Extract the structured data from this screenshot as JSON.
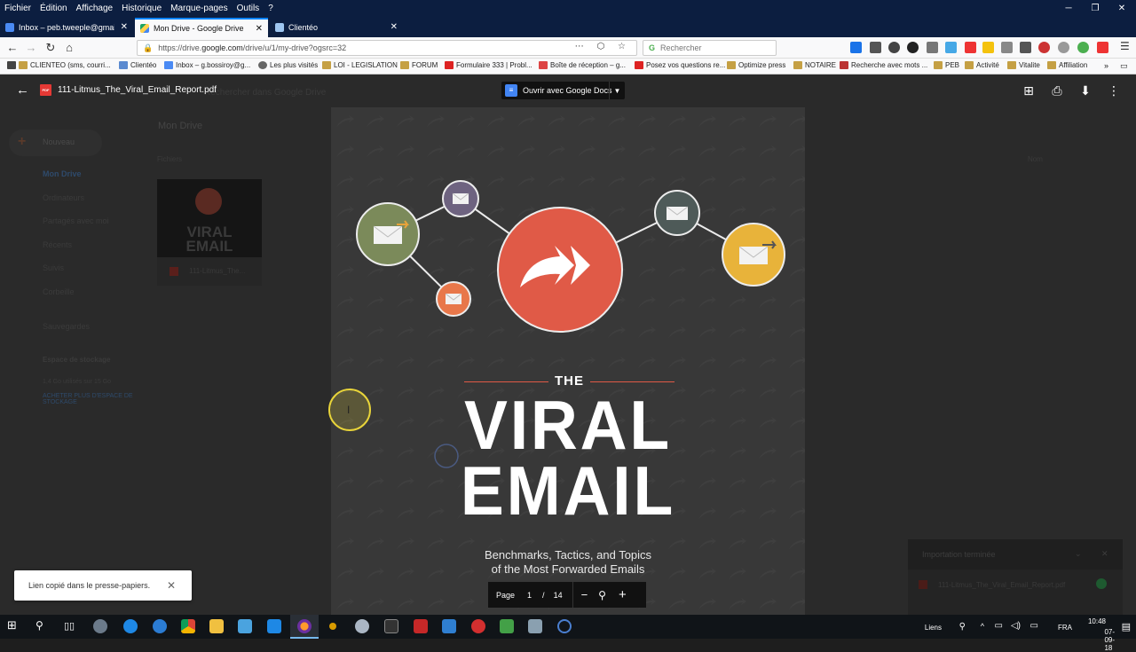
{
  "browser": {
    "menu": [
      "Fichier",
      "Édition",
      "Affichage",
      "Historique",
      "Marque-pages",
      "Outils",
      "?"
    ],
    "tabs": [
      {
        "label": "Inbox – peb.tweeple@gmail.co",
        "active": false
      },
      {
        "label": "Mon Drive - Google Drive",
        "active": true
      },
      {
        "label": "Clientéo",
        "active": false
      }
    ],
    "url_prefix": "https://drive.",
    "url_host": "google.com",
    "url_rest": "/drive/u/1/my-drive?ogsrc=32",
    "search_placeholder": "Rechercher",
    "bookmarks": [
      "CLIENTEO (sms, courri...",
      "Clientéo",
      "Inbox – g.bossiroy@g...",
      "Les plus visités",
      "LOI - LEGISLATION",
      "FORUM",
      "Formulaire 333 | Probl...",
      "Boîte de réception – g...",
      "Posez vos questions re...",
      "Optimize press",
      "NOTAIRE",
      "Recherche avec mots ...",
      "PEB",
      "Activité",
      "Vitalite",
      "Affiliation"
    ]
  },
  "drive": {
    "search_hint": "Rechercher dans Google Drive",
    "new_button": "Nouveau",
    "breadcrumb": "Mon Drive",
    "section_files": "Fichiers",
    "sort_label": "Nom",
    "sidebar": [
      "Mon Drive",
      "Ordinateurs",
      "Partagés avec moi",
      "Récents",
      "Suivis",
      "Corbeille",
      "Sauvegardes",
      "Espace de stockage"
    ],
    "storage_used": "1,4 Go utilisés sur 15 Go",
    "buy_storage": "ACHETER PLUS D'ESPACE DE STOCKAGE",
    "thumb_title_1": "VIRAL",
    "thumb_title_2": "EMAIL",
    "file_name_short": "111-Litmus_The..."
  },
  "viewer": {
    "file_name": "111-Litmus_The_Viral_Email_Report.pdf",
    "pdf_badge": "PDF",
    "open_with": "Ouvrir avec Google Docs",
    "page_label": "Page",
    "page_current": "1",
    "page_sep": "/",
    "page_total": "14"
  },
  "pdf": {
    "the": "THE",
    "title_line1": "VIRAL",
    "title_line2": "EMAIL",
    "subtitle_line1": "Benchmarks, Tactics, and Topics",
    "subtitle_line2": "of the Most Forwarded Emails"
  },
  "toast": {
    "message": "Lien copié dans le presse-papiers."
  },
  "import_panel": {
    "title": "Importation terminée",
    "file": "111-Litmus_The_Viral_Email_Report.pdf"
  },
  "taskbar": {
    "links": "Liens",
    "lang": "FRA",
    "time": "10:48",
    "date": "07-09-18"
  },
  "colors": {
    "accent_red": "#e05a47",
    "olive": "#7b8a5a",
    "purple": "#6e6380",
    "orange": "#e8774a",
    "slate": "#4e5a58",
    "yellow": "#e8b33a"
  }
}
